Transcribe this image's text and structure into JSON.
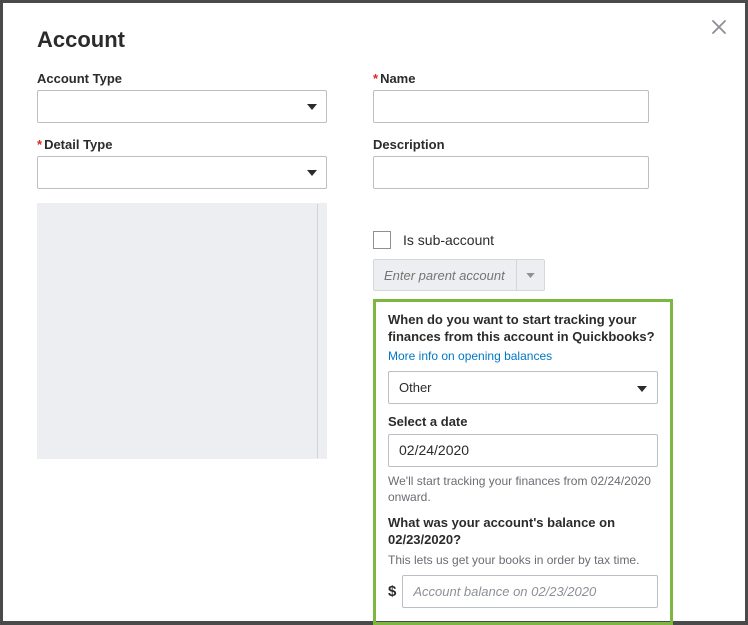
{
  "title": "Account",
  "left": {
    "account_type_label": "Account Type",
    "detail_type_label": "Detail Type"
  },
  "right": {
    "name_label": "Name",
    "description_label": "Description",
    "sub_account_label": "Is sub-account",
    "parent_placeholder": "Enter parent account"
  },
  "highlight": {
    "question1": "When do you want to start tracking your finances from this account in Quickbooks?",
    "more_info_link": "More info on opening balances",
    "select_value": "Other",
    "date_label": "Select a date",
    "date_value": "02/24/2020",
    "tracking_note": "We'll start tracking your finances from 02/24/2020 onward.",
    "question2": "What was your account's balance on 02/23/2020?",
    "tax_note": "This lets us get your books in order by tax time.",
    "currency_symbol": "$",
    "balance_placeholder": "Account balance on 02/23/2020"
  }
}
